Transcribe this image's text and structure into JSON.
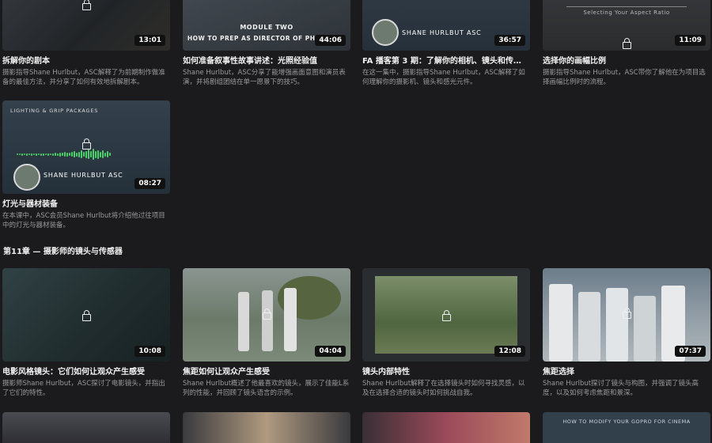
{
  "colors": {
    "accent_wave": "#4cd06a",
    "background": "#1b1b1d"
  },
  "cards_row1": [
    {
      "title": "拆解你的剧本",
      "desc": "摄影指导Shane Hurlbut，ASC解释了为前期制作做准备的最佳方法，并分享了如何有效地拆解剧本。",
      "duration": "13:01"
    },
    {
      "title": "如何准备叙事性故事讲述：光照经验值",
      "desc": "Shane Hurlbut，ASC分享了能增强画面意图和演员表演，并将剧组团结在单一愿景下的技巧。",
      "duration": "44:06",
      "overlay_line1": "MODULE TWO",
      "overlay_line2": "HOW TO PREP AS DIRECTOR OF PHOTOGRA"
    },
    {
      "title": "FA 播客第 3 期：了解你的相机、镜头和传…",
      "desc": "在这一集中，摄影指导Shane Hurlbut，ASC解释了如何理解你的摄影机、镜头和感光元件。",
      "duration": "36:57",
      "overlay_name": "SHANE HURLBUT ASC"
    },
    {
      "title": "选择你的画幅比例",
      "desc": "摄影指导Shane Hurlbut，ASC带你了解他在为项目选择画幅比例时的流程。",
      "duration": "11:09",
      "overlay_line2": "Selecting Your Aspect Ratio"
    }
  ],
  "card_row2": {
    "title": "灯光与器材装备",
    "desc": "在本课中，ASC会员Shane Hurlbut将介绍他过往项目中的灯光与器材装备。",
    "duration": "08:27",
    "overlay_top": "LIGHTING & GRIP PACKAGES",
    "overlay_name": "SHANE HURLBUT ASC"
  },
  "chapter_title": "第11章 — 摄影师的镜头与传感器",
  "cards_row3": [
    {
      "title": "电影风格镜头：它们如何让观众产生感受",
      "desc": "摄影师Shane Hurlbut，ASC探讨了电影镜头，并指出了它们的特性。",
      "duration": "10:08"
    },
    {
      "title": "焦距如何让观众产生感受",
      "desc": "Shane Hurlbut概述了他最喜欢的镜头，展示了佳能L系列的性能，并回顾了镜头语言的示例。",
      "duration": "04:04"
    },
    {
      "title": "镜头内部特性",
      "desc": "Shane Hurlbut解释了在选择镜头时如何寻找灵感，以及在选择合适的镜头时如何挑战自我。",
      "duration": "12:08"
    },
    {
      "title": "焦距选择",
      "desc": "Shane Hurlbut探讨了镜头与构图，并强调了镜头高度，以及如何考虑焦距和景深。",
      "duration": "07:37"
    }
  ],
  "row4_overlay": "HOW TO MODIFY YOUR GOPRO FOR CINEMA"
}
